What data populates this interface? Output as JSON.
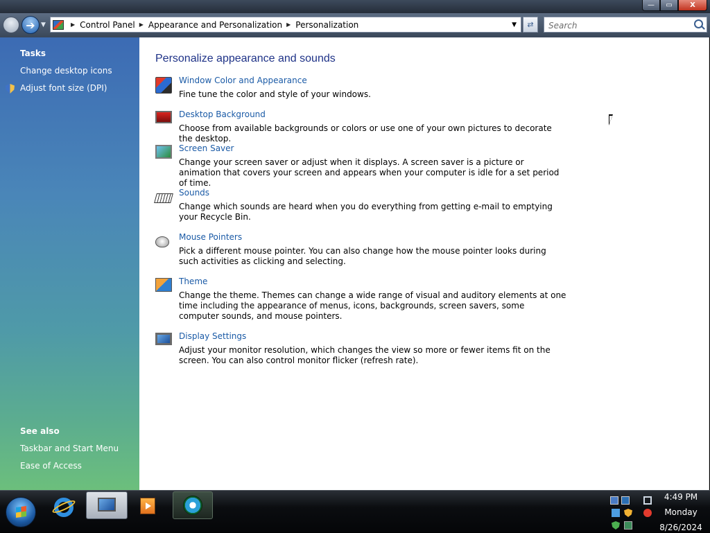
{
  "window": {
    "controls": {
      "minimize": "—",
      "maximize": "▭",
      "close": "X"
    }
  },
  "navigation": {
    "breadcrumbs": [
      "Control Panel",
      "Appearance and Personalization",
      "Personalization"
    ],
    "search_placeholder": "Search"
  },
  "tasks": {
    "heading": "Tasks",
    "items": [
      "Change desktop icons",
      "Adjust font size (DPI)"
    ]
  },
  "see_also": {
    "heading": "See also",
    "items": [
      "Taskbar and Start Menu",
      "Ease of Access"
    ]
  },
  "main": {
    "title": "Personalize appearance and sounds",
    "items": [
      {
        "title": "Window Color and Appearance",
        "description": "Fine tune the color and style of your windows.",
        "icon": "window-color-icon"
      },
      {
        "title": "Desktop Background",
        "description": "Choose from available backgrounds or colors or use one of your own pictures to decorate the desktop.",
        "icon": "desktop-background-icon"
      },
      {
        "title": "Screen Saver",
        "description": "Change your screen saver or adjust when it displays. A screen saver is a picture or animation that covers your screen and appears when your computer is idle for a set period of time.",
        "icon": "screen-saver-icon"
      },
      {
        "title": "Sounds",
        "description": "Change which sounds are heard when you do everything from getting e-mail to emptying your Recycle Bin.",
        "icon": "sounds-icon"
      },
      {
        "title": "Mouse Pointers",
        "description": "Pick a different mouse pointer. You can also change how the mouse pointer looks during such activities as clicking and selecting.",
        "icon": "mouse-pointers-icon"
      },
      {
        "title": "Theme",
        "description": "Change the theme. Themes can change a wide range of visual and auditory elements at one time including the appearance of menus, icons, backgrounds, screen savers, some computer sounds, and mouse pointers.",
        "icon": "theme-icon"
      },
      {
        "title": "Display Settings",
        "description": "Adjust your monitor resolution, which changes the view so more or fewer items fit on the screen. You can also control monitor flicker (refresh rate).",
        "icon": "display-settings-icon"
      }
    ]
  },
  "taskbar": {
    "clock": {
      "time": "4:49 PM",
      "day": "Monday",
      "date": "8/26/2024"
    }
  },
  "colors": {
    "link": "#1a5aa6",
    "title": "#1e3287",
    "pane_top": "#3c6bb4",
    "pane_bottom": "#6cbf7c"
  }
}
